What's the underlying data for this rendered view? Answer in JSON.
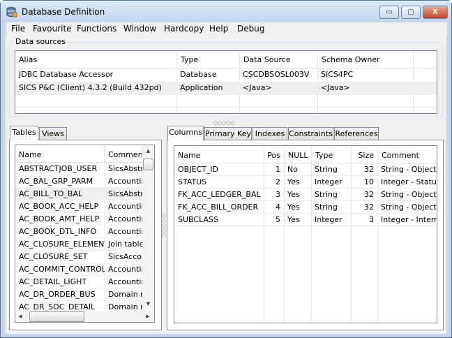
{
  "window": {
    "title": "Database Definition",
    "minimize": "▭",
    "maximize": "▢",
    "close": "X"
  },
  "menu": [
    "File",
    "Favourite",
    "Functions",
    "Window",
    "Hardcopy",
    "Help",
    "Debug"
  ],
  "data_sources": {
    "label": "Data sources",
    "headers": [
      "Alias",
      "Type",
      "Data Source",
      "Schema Owner"
    ],
    "rows": [
      [
        "JDBC Database Accessor",
        "Database",
        "CSCDBSOSL003V",
        "SICS4PC"
      ],
      [
        "SICS P&C (Client) 4.3.2  (Build 432pd)",
        "Application",
        "<Java>",
        "<Java>"
      ]
    ]
  },
  "left_tabs": [
    "Tables",
    "Views"
  ],
  "tables": {
    "headers": [
      "Name",
      "Comment"
    ],
    "rows": [
      [
        "ABSTRACTJOB_USER",
        "SicsAbstr"
      ],
      [
        "AC_BAL_GRP_PARM",
        "Accountin"
      ],
      [
        "AC_BILL_TO_BAL",
        "SicsAbstr"
      ],
      [
        "AC_BOOK_ACC_HELP",
        "Accountin"
      ],
      [
        "AC_BOOK_AMT_HELP",
        "Accountin"
      ],
      [
        "AC_BOOK_DTL_INFO",
        "Accountin"
      ],
      [
        "AC_CLOSURE_ELEMENT",
        "Join table"
      ],
      [
        "AC_CLOSURE_SET",
        "SicsAccou"
      ],
      [
        "AC_COMMIT_CONTROL",
        "Accountin"
      ],
      [
        "AC_DETAIL_LIGHT",
        "Accountin"
      ],
      [
        "AC_DR_ORDER_BUS",
        "Domain re"
      ],
      [
        "AC_DR_SOC_DETAIL",
        "Domain re"
      ]
    ],
    "selected_index": 2
  },
  "right_tabs": [
    "Columns",
    "Primary Key",
    "Indexes",
    "Constraints",
    "References"
  ],
  "columns": {
    "headers": [
      "Name",
      "Pos",
      "NULL",
      "Type",
      "Size",
      "Comment"
    ],
    "rows": [
      [
        "OBJECT_ID",
        "1",
        "No",
        "String",
        "32",
        "String - Object Id"
      ],
      [
        "STATUS",
        "2",
        "Yes",
        "Integer",
        "10",
        "Integer - Status"
      ],
      [
        "FK_ACC_LEDGER_BAL",
        "3",
        "Yes",
        "String",
        "32",
        "String - Object Id"
      ],
      [
        "FK_ACC_BILL_ORDER",
        "4",
        "Yes",
        "String",
        "32",
        "String - Object Id"
      ],
      [
        "SUBCLASS",
        "5",
        "Yes",
        "Integer",
        "3",
        "Integer - Internal"
      ]
    ]
  },
  "splitter_dots": "○○○○○"
}
